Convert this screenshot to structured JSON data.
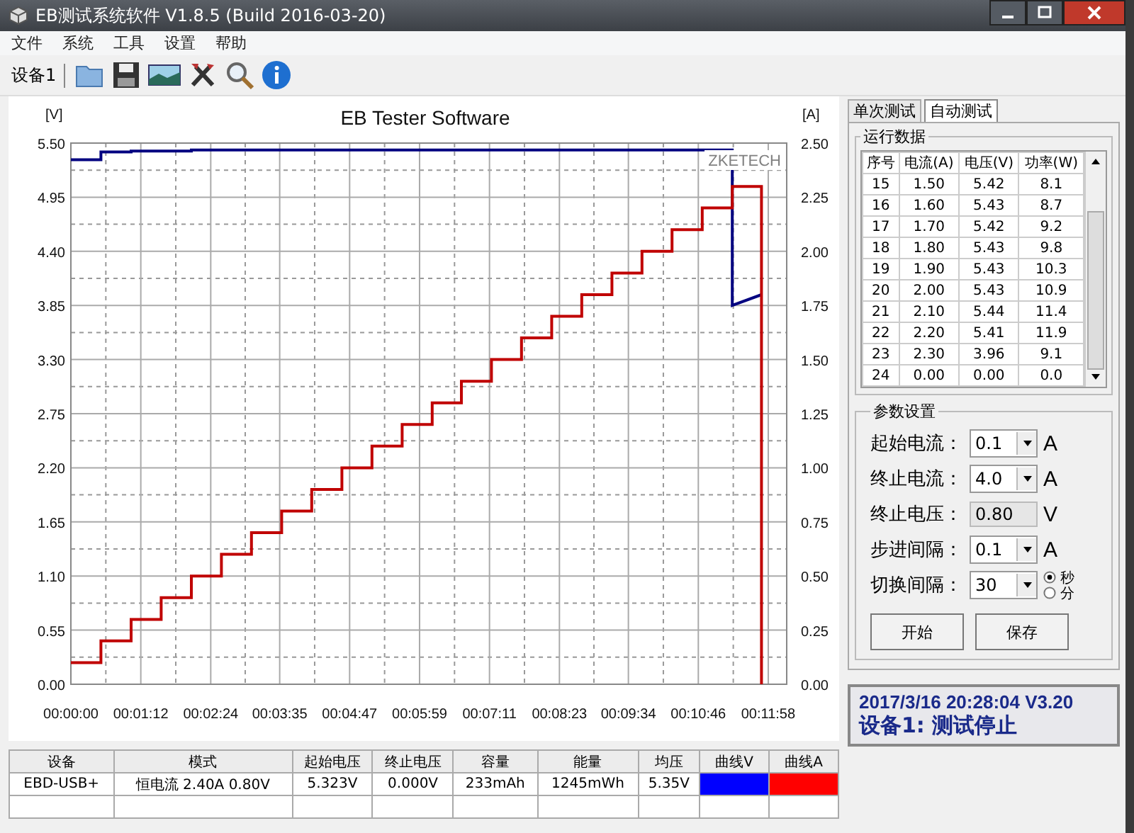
{
  "window": {
    "title": "EB测试系统软件 V1.8.5 (Build 2016-03-20)"
  },
  "menu": [
    "文件",
    "系统",
    "工具",
    "设置",
    "帮助"
  ],
  "toolbar": {
    "device_label": "设备1",
    "buttons": [
      {
        "kind": "folder"
      },
      {
        "kind": "save"
      },
      {
        "kind": "image"
      },
      {
        "kind": "tools"
      },
      {
        "kind": "search"
      },
      {
        "kind": "info"
      }
    ]
  },
  "chart": {
    "brand_label": "ZKETECH",
    "chart_data": {
      "type": "line",
      "title": "EB Tester Software",
      "ylabel": "[V]",
      "y2label": "[A]",
      "grid": true,
      "x": [
        0,
        31,
        31,
        62,
        62,
        93,
        93,
        124,
        124,
        155,
        155,
        186,
        186,
        217,
        217,
        248,
        248,
        279,
        279,
        310,
        310,
        341,
        341,
        372,
        372,
        402,
        402,
        433,
        433,
        464,
        464,
        495,
        495,
        526,
        526,
        557,
        557,
        588,
        588,
        619,
        619,
        650,
        650,
        681,
        681,
        711,
        711
      ],
      "xlim": [
        0,
        737
      ],
      "ylim": [
        0,
        5.5
      ],
      "y2lim": [
        0,
        2.5
      ],
      "xticks": [
        {
          "value": 0,
          "label": "00:00:00"
        },
        {
          "value": 72,
          "label": "00:01:12"
        },
        {
          "value": 144,
          "label": "00:02:24"
        },
        {
          "value": 215,
          "label": "00:03:35"
        },
        {
          "value": 287,
          "label": "00:04:47"
        },
        {
          "value": 359,
          "label": "00:05:59"
        },
        {
          "value": 431,
          "label": "00:07:11"
        },
        {
          "value": 503,
          "label": "00:08:23"
        },
        {
          "value": 574,
          "label": "00:09:34"
        },
        {
          "value": 646,
          "label": "00:10:46"
        },
        {
          "value": 718,
          "label": "00:11:58"
        }
      ],
      "yticks": [
        {
          "value": 0,
          "label": "0.00"
        },
        {
          "value": 0.55,
          "label": "0.55"
        },
        {
          "value": 1.1,
          "label": "1.10"
        },
        {
          "value": 1.65,
          "label": "1.65"
        },
        {
          "value": 2.2,
          "label": "2.20"
        },
        {
          "value": 2.75,
          "label": "2.75"
        },
        {
          "value": 3.3,
          "label": "3.30"
        },
        {
          "value": 3.85,
          "label": "3.85"
        },
        {
          "value": 4.4,
          "label": "4.40"
        },
        {
          "value": 4.95,
          "label": "4.95"
        },
        {
          "value": 5.5,
          "label": "5.50"
        }
      ],
      "y2ticks": [
        {
          "value": 0,
          "label": "0.00"
        },
        {
          "value": 0.25,
          "label": "0.25"
        },
        {
          "value": 0.5,
          "label": "0.50"
        },
        {
          "value": 0.75,
          "label": "0.75"
        },
        {
          "value": 1,
          "label": "1.00"
        },
        {
          "value": 1.25,
          "label": "1.25"
        },
        {
          "value": 1.5,
          "label": "1.50"
        },
        {
          "value": 1.75,
          "label": "1.75"
        },
        {
          "value": 2,
          "label": "2.00"
        },
        {
          "value": 2.25,
          "label": "2.25"
        },
        {
          "value": 2.5,
          "label": "2.50"
        }
      ],
      "series": [
        {
          "color": "#000080",
          "values": [
            5.33,
            5.33,
            5.41,
            5.41,
            5.42,
            5.42,
            5.42,
            5.42,
            5.43,
            5.43,
            5.43,
            5.43,
            5.43,
            5.43,
            5.43,
            5.43,
            5.43,
            5.43,
            5.43,
            5.43,
            5.43,
            5.43,
            5.43,
            5.43,
            5.43,
            5.43,
            5.43,
            5.43,
            5.43,
            5.43,
            5.43,
            5.43,
            5.43,
            5.43,
            5.43,
            5.43,
            5.43,
            5.43,
            5.43,
            5.43,
            5.43,
            5.43,
            5.43,
            5.43,
            3.85,
            3.96,
            3.96
          ]
        },
        {
          "color": "#c00000",
          "axis": "y2",
          "values": [
            0.1,
            0.1,
            0.2,
            0.2,
            0.3,
            0.3,
            0.4,
            0.4,
            0.5,
            0.5,
            0.6,
            0.6,
            0.7,
            0.7,
            0.8,
            0.8,
            0.9,
            0.9,
            1.0,
            1.0,
            1.1,
            1.1,
            1.2,
            1.2,
            1.3,
            1.3,
            1.4,
            1.4,
            1.5,
            1.5,
            1.6,
            1.6,
            1.7,
            1.7,
            1.8,
            1.8,
            1.9,
            1.9,
            2.0,
            2.0,
            2.1,
            2.1,
            2.2,
            2.2,
            2.3,
            2.3,
            0.0
          ]
        }
      ]
    }
  },
  "summary_table": {
    "columns": [
      "设备",
      "模式",
      "起始电压",
      "终止电压",
      "容量",
      "能量",
      "均压",
      "曲线V",
      "曲线A"
    ],
    "rows": [
      {
        "cells": [
          "EBD-USB+",
          "恒电流  2.40A  0.80V",
          "5.323V",
          "0.000V",
          "233mAh",
          "1245mWh",
          "5.35V"
        ],
        "curves": [
          {
            "color": "#0000ff"
          },
          {
            "color": "#ff0000"
          }
        ]
      }
    ]
  },
  "tabs": [
    {
      "label": "单次测试",
      "selected": false
    },
    {
      "label": "自动测试",
      "selected": true
    }
  ],
  "run_data": {
    "title": "运行数据",
    "columns": [
      "序号",
      "电流(A)",
      "电压(V)",
      "功率(W)"
    ],
    "rows": [
      [
        "15",
        "1.50",
        "5.42",
        "8.1"
      ],
      [
        "16",
        "1.60",
        "5.43",
        "8.7"
      ],
      [
        "17",
        "1.70",
        "5.42",
        "9.2"
      ],
      [
        "18",
        "1.80",
        "5.43",
        "9.8"
      ],
      [
        "19",
        "1.90",
        "5.43",
        "10.3"
      ],
      [
        "20",
        "2.00",
        "5.43",
        "10.9"
      ],
      [
        "21",
        "2.10",
        "5.44",
        "11.4"
      ],
      [
        "22",
        "2.20",
        "5.41",
        "11.9"
      ],
      [
        "23",
        "2.30",
        "3.96",
        "9.1"
      ],
      [
        "24",
        "0.00",
        "0.00",
        "0.0"
      ]
    ]
  },
  "params": {
    "title": "参数设置",
    "fields": [
      {
        "label": "起始电流：",
        "value": "0.1",
        "kind": "combo",
        "unit": "A"
      },
      {
        "label": "终止电流：",
        "value": "4.0",
        "kind": "combo",
        "unit": "A"
      },
      {
        "label": "终止电压：",
        "value": "0.80",
        "kind": "text",
        "unit": "V"
      },
      {
        "label": "步进间隔：",
        "value": "0.1",
        "kind": "combo",
        "unit": "A"
      },
      {
        "label": "切换间隔：",
        "value": "30",
        "kind": "combo",
        "units": [
          {
            "label": "秒",
            "selected": true
          },
          {
            "label": "分",
            "selected": false
          }
        ]
      }
    ],
    "buttons": [
      "开始",
      "保存"
    ]
  },
  "status": {
    "line1": "2017/3/16 20:28:04  V3.20",
    "line2": "设备1: 测试停止"
  }
}
